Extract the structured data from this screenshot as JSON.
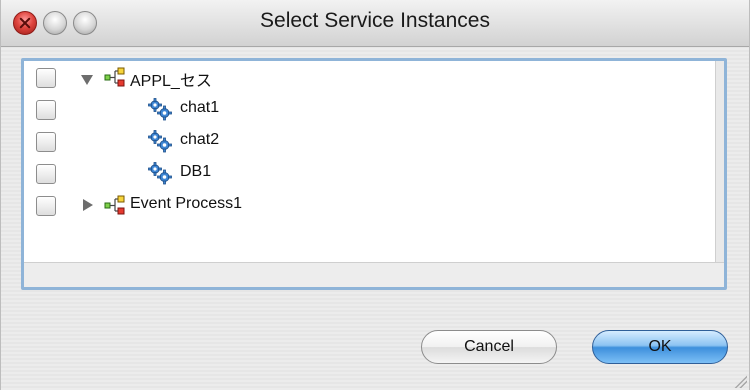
{
  "window": {
    "title": "Select Service Instances"
  },
  "tree": {
    "rows": [
      {
        "kind": "application",
        "label": "APPL_セス",
        "expanded": true,
        "checked": false
      },
      {
        "kind": "instance",
        "label": "chat1",
        "checked": false
      },
      {
        "kind": "instance",
        "label": "chat2",
        "checked": false
      },
      {
        "kind": "instance",
        "label": "DB1",
        "checked": false
      },
      {
        "kind": "application",
        "label": "Event Process1",
        "expanded": false,
        "checked": false
      }
    ]
  },
  "buttons": {
    "cancel_label": "Cancel",
    "ok_label": "OK"
  },
  "colors": {
    "accent": "#3d8fdc",
    "close": "#e0463f",
    "focus_ring": "#8fb4d8"
  },
  "icons": {
    "application": "component-tree-icon",
    "instance": "gears-icon",
    "expanded": "disclosure-down-icon",
    "collapsed": "disclosure-right-icon"
  }
}
